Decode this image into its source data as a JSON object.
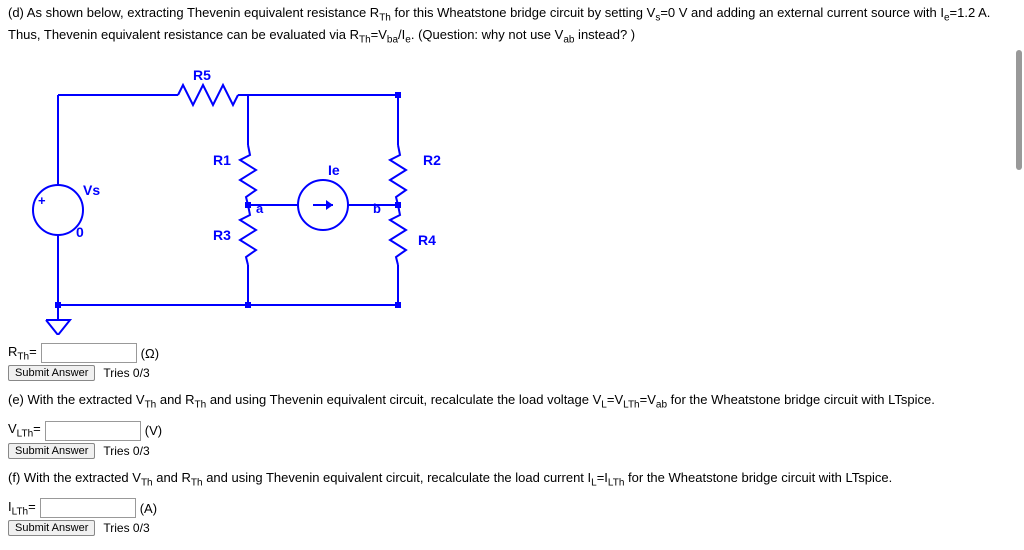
{
  "partD": {
    "text": "(d) As shown below, extracting Thevenin equivalent resistance R_Th for this Wheatstone bridge circuit by setting V_s=0 V and adding an external current source with I_e=1.2 A. Thus, Thevenin equivalent resistance can be evaluated via R_Th=V_ba/I_e. (Question: why not use V_ab instead? )",
    "circuit": {
      "R5": "R5",
      "R1": "R1",
      "R2": "R2",
      "R3": "R3",
      "R4": "R4",
      "Vs": "Vs",
      "Ie": "Ie",
      "a": "a",
      "b": "b",
      "zero": "0",
      "plus": "+"
    },
    "answer_label": "R_Th=",
    "unit": "(Ω)",
    "submit": "Submit Answer",
    "tries": "Tries 0/3"
  },
  "partE": {
    "text": "(e) With the extracted V_Th and R_Th and using Thevenin equivalent circuit, recalculate the load voltage V_L=V_LTh=V_ab for the Wheatstone bridge circuit with LTspice.",
    "answer_label": "V_LTh=",
    "unit": "(V)",
    "submit": "Submit Answer",
    "tries": "Tries 0/3"
  },
  "partF": {
    "text": "(f) With the extracted V_Th and R_Th and using Thevenin equivalent circuit, recalculate the load current I_L=I_LTh for the Wheatstone bridge circuit with LTspice.",
    "answer_label": "I_LTh=",
    "unit": "(A)",
    "submit": "Submit Answer",
    "tries": "Tries 0/3"
  }
}
